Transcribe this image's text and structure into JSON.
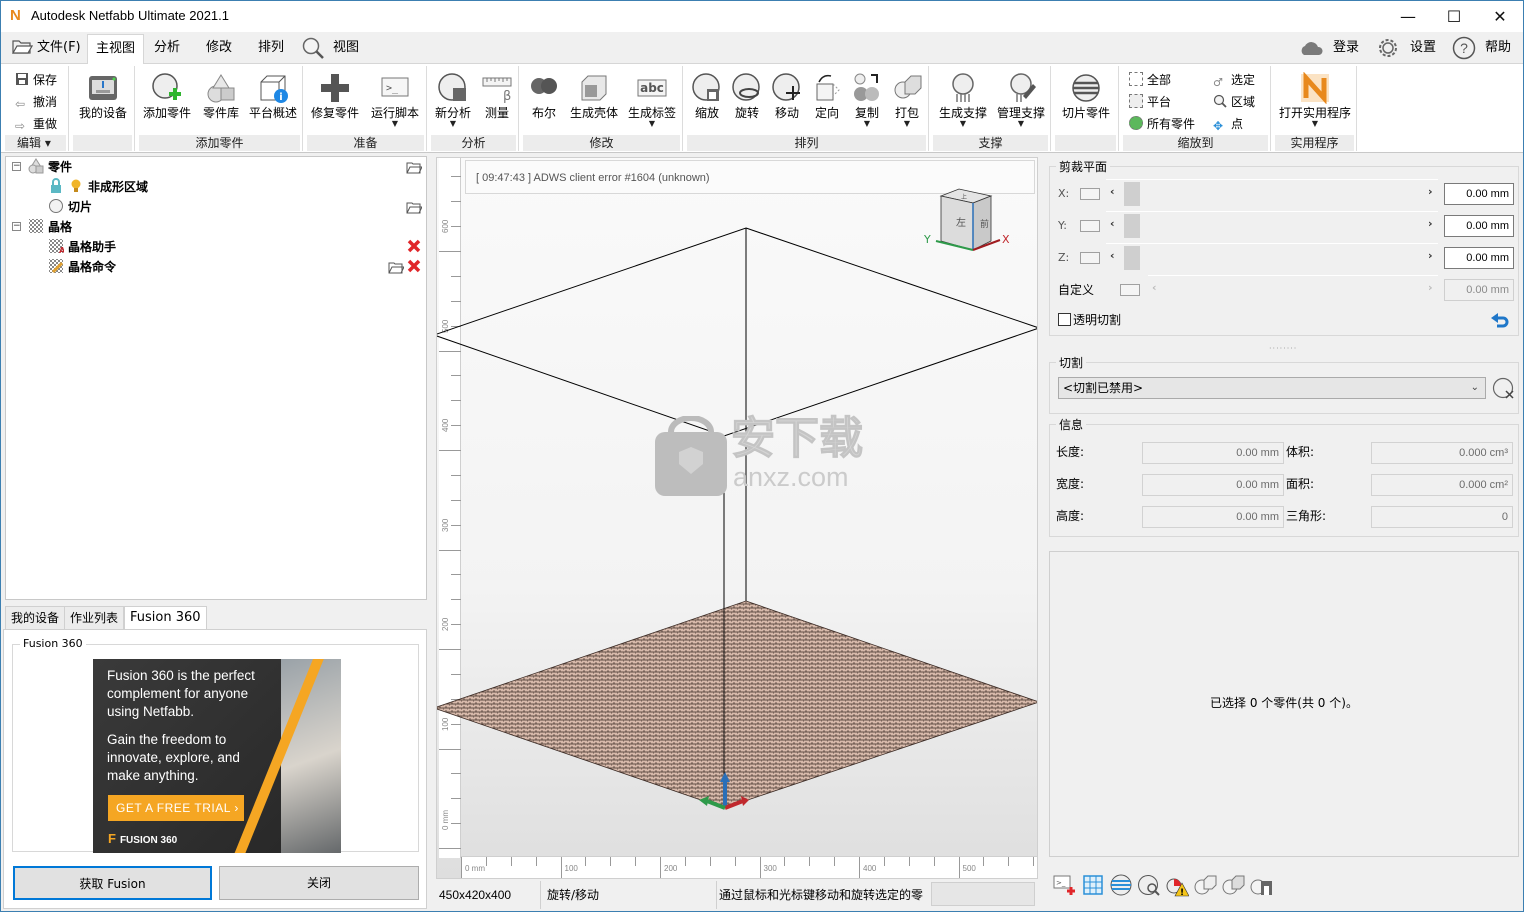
{
  "window": {
    "title": "Autodesk Netfabb Ultimate 2021.1",
    "logo": "N",
    "controls": {
      "minimize": "—",
      "maximize": "☐",
      "close": "✕"
    }
  },
  "menu": {
    "file": "文件(F)",
    "tabs": [
      {
        "label": "主视图",
        "active": true
      },
      {
        "label": "分析",
        "active": false
      },
      {
        "label": "修改",
        "active": false
      },
      {
        "label": "排列",
        "active": false
      },
      {
        "label": "视图",
        "active": false
      }
    ],
    "right": {
      "login": "登录",
      "settings": "设置",
      "help": "帮助"
    }
  },
  "ribbon": {
    "edit": {
      "save": "保存",
      "undo": "撤消",
      "redo": "重做",
      "label": "编辑 ▾"
    },
    "groups": [
      {
        "label": "",
        "buttons": [
          {
            "label": "我的设备",
            "icon": "printer-icon"
          }
        ]
      },
      {
        "label": "添加零件",
        "buttons": [
          {
            "label": "添加零件",
            "icon": "add-part-icon"
          },
          {
            "label": "零件库",
            "icon": "part-library-icon"
          },
          {
            "label": "平台概述",
            "icon": "platform-overview-icon"
          }
        ]
      },
      {
        "label": "准备",
        "buttons": [
          {
            "label": "修复零件",
            "icon": "repair-icon"
          },
          {
            "label": "运行脚本",
            "icon": "script-icon",
            "dropdown": true
          }
        ]
      },
      {
        "label": "分析",
        "buttons": [
          {
            "label": "新分析",
            "icon": "new-analysis-icon",
            "dropdown": true
          },
          {
            "label": "测量",
            "icon": "measure-icon"
          }
        ]
      },
      {
        "label": "修改",
        "buttons": [
          {
            "label": "布尔",
            "icon": "boolean-icon"
          },
          {
            "label": "生成壳体",
            "icon": "shell-icon"
          },
          {
            "label": "生成标签",
            "icon": "label-icon",
            "dropdown": true
          }
        ]
      },
      {
        "label": "排列",
        "buttons": [
          {
            "label": "缩放",
            "icon": "scale-icon"
          },
          {
            "label": "旋转",
            "icon": "rotate-icon"
          },
          {
            "label": "移动",
            "icon": "move-icon"
          },
          {
            "label": "定向",
            "icon": "orient-icon"
          },
          {
            "label": "复制",
            "icon": "duplicate-icon",
            "dropdown": true
          },
          {
            "label": "打包",
            "icon": "pack-icon",
            "dropdown": true
          }
        ]
      },
      {
        "label": "支撑",
        "buttons": [
          {
            "label": "生成支撑",
            "icon": "generate-support-icon",
            "dropdown": true
          },
          {
            "label": "管理支撑",
            "icon": "manage-support-icon",
            "dropdown": true
          }
        ]
      },
      {
        "label": "",
        "buttons": [
          {
            "label": "切片零件",
            "icon": "slice-icon"
          }
        ]
      },
      {
        "label": "缩放到",
        "small": [
          {
            "label": "全部",
            "icon": "zoom-all-icon"
          },
          {
            "label": "平台",
            "icon": "zoom-platform-icon"
          },
          {
            "label": "所有零件",
            "icon": "zoom-parts-icon"
          },
          {
            "label": "选定",
            "icon": "zoom-selected-icon"
          },
          {
            "label": "区域",
            "icon": "zoom-region-icon"
          },
          {
            "label": "点",
            "icon": "zoom-point-icon"
          }
        ]
      },
      {
        "label": "实用程序",
        "buttons": [
          {
            "label": "打开实用程序",
            "icon": "netfabb-utilities-icon",
            "dropdown": true
          }
        ]
      }
    ]
  },
  "tree": {
    "items": [
      {
        "label": "零件",
        "level": 0,
        "icon": "parts-icon",
        "expander": "−",
        "folder": true
      },
      {
        "label": "非成形区域",
        "level": 1,
        "icon": "lock-icon"
      },
      {
        "label": "切片",
        "level": 1,
        "icon": "slice-circle-icon",
        "folder": true
      },
      {
        "label": "晶格",
        "level": 0,
        "icon": "lattice-icon",
        "expander": "−"
      },
      {
        "label": "晶格助手",
        "level": 1,
        "icon": "lattice-assistant-icon",
        "delete": true
      },
      {
        "label": "晶格命令",
        "level": 1,
        "icon": "lattice-command-icon",
        "folder": true,
        "delete": true
      }
    ]
  },
  "bottom_tabs": [
    {
      "label": "我的设备",
      "active": false
    },
    {
      "label": "作业列表",
      "active": false
    },
    {
      "label": "Fusion 360",
      "active": true
    }
  ],
  "fusion": {
    "legend": "Fusion 360",
    "ad_line1": "Fusion 360 is the perfect",
    "ad_line2": "complement for anyone",
    "ad_line3": "using Netfabb.",
    "ad_line4": "Gain the freedom to",
    "ad_line5": "innovate, explore, and",
    "ad_line6": "make anything.",
    "cta": "GET A FREE TRIAL  ›",
    "brand": "FUSION 360",
    "get_button": "获取 Fusion",
    "close_button": "关闭"
  },
  "viewport": {
    "log": "[ 09:47:43 ] ADWS client error #1604 (unknown)",
    "viewcube": {
      "left": "左",
      "front": "前",
      "top": "上",
      "x": "X",
      "y": "Y"
    },
    "v_ruler": [
      "0 mm",
      "100",
      "200",
      "300",
      "400",
      "500",
      "600"
    ],
    "h_ruler": [
      "0 mm",
      "100",
      "200",
      "300",
      "400",
      "500"
    ],
    "watermark": {
      "cn": "安下载",
      "en": "anxz.com"
    }
  },
  "status": {
    "dimensions": "450x420x400",
    "mode": "旋转/移动",
    "hint": "通过鼠标和光标键移动和旋转选定的零"
  },
  "clipping": {
    "legend": "剪裁平面",
    "rows": [
      {
        "label": "X:",
        "value": "0.00 mm",
        "enabled": true
      },
      {
        "label": "Y:",
        "value": "0.00 mm",
        "enabled": true
      },
      {
        "label": "Z:",
        "value": "0.00 mm",
        "enabled": true
      },
      {
        "label": "自定义",
        "value": "0.00 mm",
        "enabled": false
      }
    ],
    "transparent": "透明切割",
    "transparent_checked": false
  },
  "cutting": {
    "legend": "切割",
    "selected": "<切割已禁用>"
  },
  "info": {
    "legend": "信息",
    "length_label": "长度:",
    "length": "0.00 mm",
    "width_label": "宽度:",
    "width": "0.00 mm",
    "height_label": "高度:",
    "height": "0.00 mm",
    "volume_label": "体积:",
    "volume": "0.000 cm³",
    "area_label": "面积:",
    "area": "0.000 cm²",
    "triangles_label": "三角形:",
    "triangles": "0"
  },
  "selection": {
    "text": "已选择 0 个零件(共 0 个)。"
  },
  "bottom_toolbar": [
    "script-add-icon",
    "lattice-cube-icon",
    "slice-stack-icon",
    "inspect-icon",
    "warning-part-icon",
    "merge-icon",
    "split-icon",
    "export-icon"
  ],
  "colors": {
    "accent": "#3c7fb1",
    "orange": "#f5a623",
    "delete": "#e0262a",
    "axis_x": "#c0282d",
    "axis_y": "#2e9a4a",
    "axis_z": "#2a6fb8",
    "platform": "#d9b8a8"
  }
}
